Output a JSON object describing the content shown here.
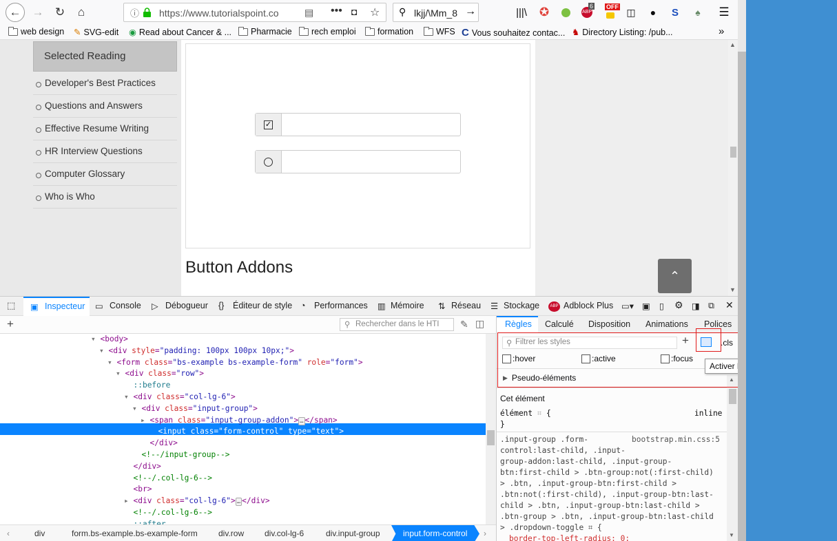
{
  "browser": {
    "url": "https://www.tutorialspoint.co",
    "search": "lkjj/\\Mm_8",
    "badge_count": "6",
    "badge_off": "OFF",
    "ext_s": "S"
  },
  "bookmarks": [
    "web design",
    "SVG-edit",
    "Read about Cancer & ...",
    "Pharmacie",
    "rech emploi",
    "formation",
    "WFS",
    "Vous souhaitez contac...",
    "Directory Listing: /pub..."
  ],
  "page": {
    "sidebar_heading": "Selected Reading",
    "sidebar_items": [
      "Developer's Best Practices",
      "Questions and Answers",
      "Effective Resume Writing",
      "HR Interview Questions",
      "Computer Glossary",
      "Who is Who"
    ],
    "heading": "Button Addons",
    "to_top": "⌃"
  },
  "devtools": {
    "tabs": [
      "Inspecteur",
      "Console",
      "Débogueur",
      "Éditeur de style",
      "Performances",
      "Mémoire",
      "Réseau",
      "Stockage",
      "Adblock Plus"
    ],
    "html_search_placeholder": "Rechercher dans le HTI",
    "markup": [
      {
        "ind": 132,
        "arrow": "▾",
        "t": [
          [
            "tg",
            "<body>"
          ]
        ]
      },
      {
        "ind": 144,
        "arrow": "▾",
        "t": [
          [
            "tg",
            "<div "
          ],
          [
            "an",
            "style"
          ],
          [
            "tg",
            "="
          ],
          [
            "av",
            "\"padding: 100px 100px 10px;\""
          ],
          [
            "tg",
            ">"
          ]
        ]
      },
      {
        "ind": 156,
        "arrow": "▾",
        "t": [
          [
            "tg",
            "<form "
          ],
          [
            "an",
            "class"
          ],
          [
            "tg",
            "="
          ],
          [
            "av",
            "\"bs-example bs-example-form\""
          ],
          [
            "tg",
            " "
          ],
          [
            "an",
            "role"
          ],
          [
            "tg",
            "="
          ],
          [
            "av",
            "\"form\""
          ],
          [
            "tg",
            ">"
          ]
        ]
      },
      {
        "ind": 168,
        "arrow": "▾",
        "t": [
          [
            "tg",
            "<div "
          ],
          [
            "an",
            "class"
          ],
          [
            "tg",
            "="
          ],
          [
            "av",
            "\"row\""
          ],
          [
            "tg",
            ">"
          ]
        ]
      },
      {
        "ind": 180,
        "arrow": "",
        "t": [
          [
            "pc",
            "::before"
          ]
        ]
      },
      {
        "ind": 180,
        "arrow": "▾",
        "t": [
          [
            "tg",
            "<div "
          ],
          [
            "an",
            "class"
          ],
          [
            "tg",
            "="
          ],
          [
            "av",
            "\"col-lg-6\""
          ],
          [
            "tg",
            ">"
          ]
        ]
      },
      {
        "ind": 192,
        "arrow": "▾",
        "t": [
          [
            "tg",
            "<div "
          ],
          [
            "an",
            "class"
          ],
          [
            "tg",
            "="
          ],
          [
            "av",
            "\"input-group\""
          ],
          [
            "tg",
            ">"
          ]
        ]
      },
      {
        "ind": 204,
        "arrow": "▸",
        "t": [
          [
            "tg",
            "<span "
          ],
          [
            "an",
            "class"
          ],
          [
            "tg",
            "="
          ],
          [
            "av",
            "\"input-group-addon\""
          ],
          [
            "tg",
            ">"
          ],
          [
            "el",
            "…"
          ],
          [
            "tg",
            "</span>"
          ]
        ]
      },
      {
        "ind": 216,
        "arrow": "",
        "sel": true,
        "t": [
          [
            "tg",
            "<input "
          ],
          [
            "an",
            "class"
          ],
          [
            "tg",
            "="
          ],
          [
            "av",
            "\"form-control\""
          ],
          [
            "tg",
            " "
          ],
          [
            "an",
            "type"
          ],
          [
            "tg",
            "="
          ],
          [
            "av",
            "\"text\""
          ],
          [
            "tg",
            ">"
          ]
        ]
      },
      {
        "ind": 204,
        "arrow": "",
        "t": [
          [
            "tg",
            "</div>"
          ]
        ]
      },
      {
        "ind": 192,
        "arrow": "",
        "t": [
          [
            "cm",
            "<!--/input-group-->"
          ]
        ]
      },
      {
        "ind": 180,
        "arrow": "",
        "t": [
          [
            "tg",
            "</div>"
          ]
        ]
      },
      {
        "ind": 180,
        "arrow": "",
        "t": [
          [
            "cm",
            "<!--/.col-lg-6-->"
          ]
        ]
      },
      {
        "ind": 180,
        "arrow": "",
        "t": [
          [
            "tg",
            "<br>"
          ]
        ]
      },
      {
        "ind": 180,
        "arrow": "▸",
        "t": [
          [
            "tg",
            "<div "
          ],
          [
            "an",
            "class"
          ],
          [
            "tg",
            "="
          ],
          [
            "av",
            "\"col-lg-6\""
          ],
          [
            "tg",
            ">"
          ],
          [
            "el",
            "…"
          ],
          [
            "tg",
            "</div>"
          ]
        ]
      },
      {
        "ind": 180,
        "arrow": "",
        "t": [
          [
            "cm",
            "<!--/.col-lg-6-->"
          ]
        ]
      },
      {
        "ind": 180,
        "arrow": "",
        "t": [
          [
            "pc",
            "::after"
          ]
        ]
      }
    ],
    "breadcrumbs": [
      "div",
      "form.bs-example.bs-example-form",
      "div.row",
      "div.col-lg-6",
      "div.input-group",
      "input.form-control"
    ],
    "rules_tabs": [
      "Règles",
      "Calculé",
      "Disposition",
      "Animations",
      "Polices"
    ],
    "filter_placeholder": "Filtrer les styles",
    "cls_label": ".cls",
    "pseudo_classes": [
      ":hover",
      ":active",
      ":focus"
    ],
    "tooltip": "Activer les pseudo-classes",
    "pseudo_elements": "Pseudo-éléments",
    "this_element": "Cet élément",
    "element_rule": "élément",
    "element_rule_open": "{",
    "inline": "inline",
    "close_brace": "}",
    "source": "bootstrap.min.css:5",
    "selector_lines": [
      ".input-group .form-",
      "control:last-child, .input-",
      "group-addon:last-child, .input-group-",
      "btn:first-child > .btn-group:not(:first-child)",
      "> .btn, .input-group-btn:first-child >",
      ".btn:not(:first-child), .input-group-btn:last-",
      "child > .btn, .input-group-btn:last-child >",
      ".btn-group > .btn, .input-group-btn:last-child",
      "> .dropdown-toggle"
    ],
    "decl": "border-top-left-radius: 0;"
  }
}
